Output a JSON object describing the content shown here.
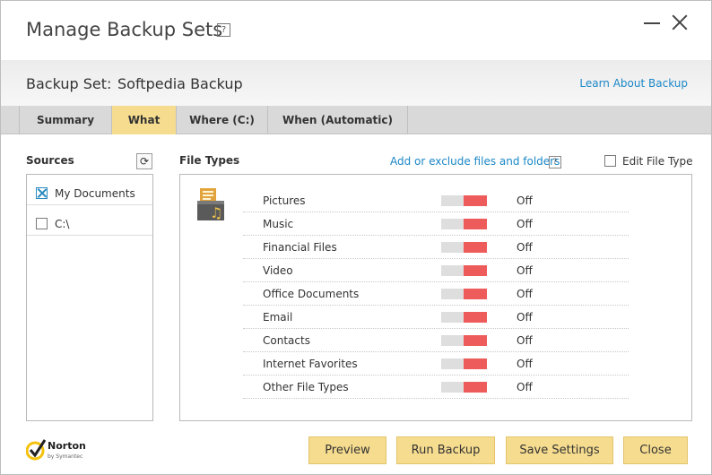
{
  "window": {
    "title": "Manage Backup Sets",
    "help_label": "?"
  },
  "backup_set": {
    "label": "Backup Set:",
    "name": "Softpedia Backup",
    "learn_link": "Learn About Backup"
  },
  "tabs": [
    {
      "label": "Summary",
      "active": false
    },
    {
      "label": "What",
      "active": true
    },
    {
      "label": "Where (C:)",
      "active": false
    },
    {
      "label": "When (Automatic)",
      "active": false
    }
  ],
  "sources": {
    "title": "Sources",
    "refresh_glyph": "⟳",
    "items": [
      {
        "label": "My Documents",
        "checked": true
      },
      {
        "label": "C:\\",
        "checked": false
      }
    ]
  },
  "file_types": {
    "title": "File Types",
    "add_link": "Add or exclude files and folders",
    "help_label": "?",
    "edit_label": "Edit File Type",
    "edit_checked": false,
    "items": [
      {
        "name": "Pictures",
        "state": "Off"
      },
      {
        "name": "Music",
        "state": "Off"
      },
      {
        "name": "Financial Files",
        "state": "Off"
      },
      {
        "name": "Video",
        "state": "Off"
      },
      {
        "name": "Office Documents",
        "state": "Off"
      },
      {
        "name": "Email",
        "state": "Off"
      },
      {
        "name": "Contacts",
        "state": "Off"
      },
      {
        "name": "Internet Favorites",
        "state": "Off"
      },
      {
        "name": "Other File Types",
        "state": "Off"
      }
    ]
  },
  "buttons": {
    "preview": "Preview",
    "run_backup": "Run Backup",
    "save_settings": "Save Settings",
    "close": "Close"
  },
  "brand": {
    "name": "Norton",
    "sub": "by Symantec"
  },
  "colors": {
    "accent_yellow": "#f6dc8f",
    "link_blue": "#1b87c7",
    "toggle_off_red": "#ee5b5b"
  }
}
